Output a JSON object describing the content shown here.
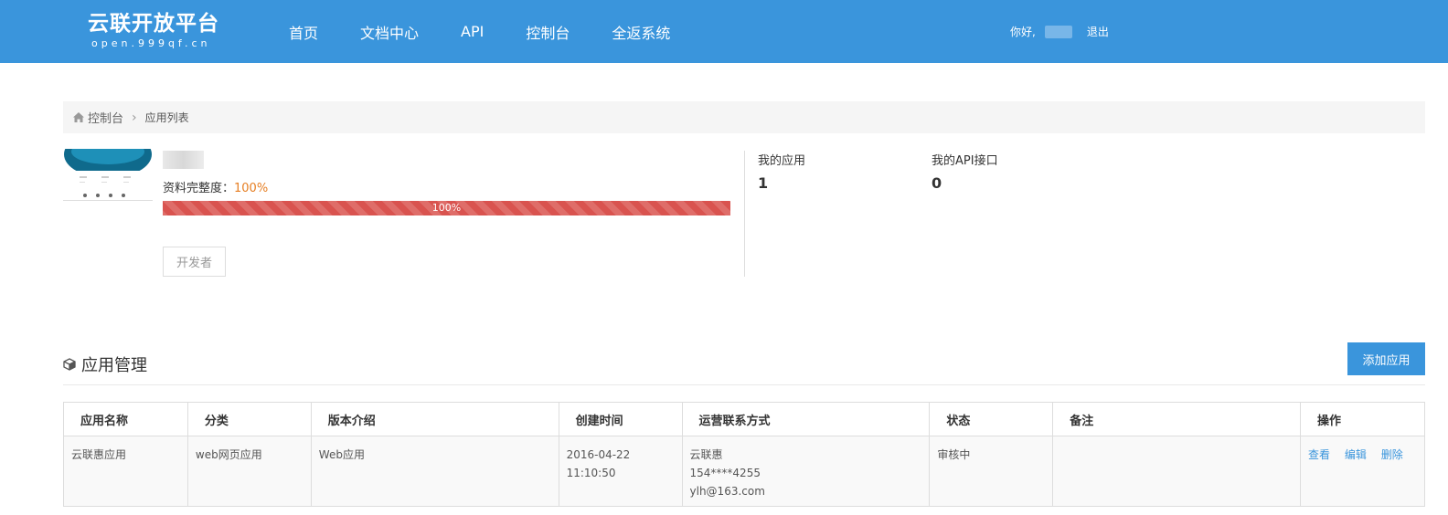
{
  "header": {
    "logo_title": "云联开放平台",
    "logo_sub": "open.999qf.cn",
    "nav": [
      "首页",
      "文档中心",
      "API",
      "控制台",
      "全返系统"
    ],
    "greeting": "你好,",
    "logout": "退出"
  },
  "breadcrumb": {
    "home_icon": "home-icon",
    "home": "控制台",
    "separator": "›",
    "current": "应用列表"
  },
  "profile": {
    "completeness_label": "资料完整度：",
    "completeness_value": "100%",
    "progress": 1.0,
    "progress_label": "100%",
    "role": "开发者"
  },
  "stats": {
    "apps_label": "我的应用",
    "apps_value": "1",
    "api_label": "我的API接口",
    "api_value": "0"
  },
  "section": {
    "icon": "cube-icon",
    "title": "应用管理",
    "add_button": "添加应用"
  },
  "table": {
    "headers": [
      "应用名称",
      "分类",
      "版本介绍",
      "创建时间",
      "运营联系方式",
      "状态",
      "备注",
      "操作"
    ],
    "rows": [
      {
        "name": "云联惠应用",
        "category": "web网页应用",
        "version": "Web应用",
        "created": "2016-04-22 11:10:50",
        "contact_name": "云联惠",
        "contact_phone": "154****4255",
        "contact_email": "ylh@163.com",
        "status": "审核中",
        "remark": "",
        "actions": [
          "查看",
          "编辑",
          "删除"
        ]
      }
    ]
  },
  "colors": {
    "brand": "#3a95dc",
    "progress": "#d9534f",
    "accent_orange": "#e67e22",
    "status_green": "#1ab394"
  }
}
